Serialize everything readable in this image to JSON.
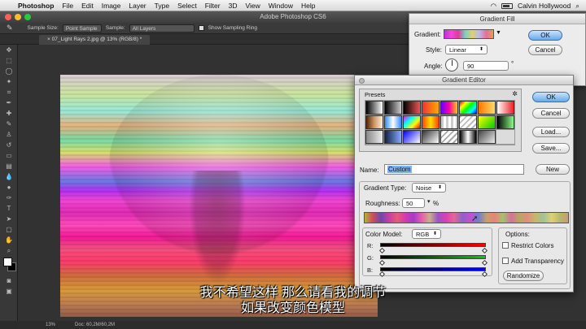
{
  "menubar": {
    "apple_icon": "apple-icon",
    "app": "Photoshop",
    "items": [
      "File",
      "Edit",
      "Image",
      "Layer",
      "Type",
      "Select",
      "Filter",
      "3D",
      "View",
      "Window",
      "Help"
    ],
    "user": "Calvin Hollywood"
  },
  "window": {
    "title": "Adobe Photoshop CS6"
  },
  "options": {
    "sample_size_label": "Sample Size:",
    "sample_size_value": "Point Sample",
    "sample_label": "Sample:",
    "sample_value": "All Layers",
    "show_ring_label": "Show Sampling Ring"
  },
  "document": {
    "tab": "07_Light Rays 2.jpg @ 13% (RGB/8) *"
  },
  "status": {
    "zoom": "13%",
    "doc": "Doc: 60,2M/60,2M"
  },
  "subtitles": {
    "line1": "我不希望这样 那么请看我的调节",
    "line2": "如果改变颜色模型"
  },
  "gradient_fill": {
    "title": "Gradient Fill",
    "gradient_label": "Gradient:",
    "style_label": "Style:",
    "style_value": "Linear",
    "angle_label": "Angle:",
    "angle_value": "90",
    "degree": "°",
    "ok": "OK",
    "cancel": "Cancel"
  },
  "gradient_editor": {
    "title": "Gradient Editor",
    "presets_label": "Presets",
    "buttons": {
      "ok": "OK",
      "cancel": "Cancel",
      "load": "Load...",
      "save": "Save...",
      "new": "New"
    },
    "name_label": "Name:",
    "name_value": "Custom",
    "gradient_type_label": "Gradient Type:",
    "gradient_type_value": "Noise",
    "roughness_label": "Roughness:",
    "roughness_value": "50",
    "roughness_unit": "%",
    "color_model_label": "Color Model:",
    "color_model_value": "RGB",
    "r_label": "R:",
    "g_label": "G:",
    "b_label": "B:",
    "options_label": "Options:",
    "restrict_colors": "Restrict Colors",
    "add_transparency": "Add Transparency",
    "randomize": "Randomize"
  }
}
